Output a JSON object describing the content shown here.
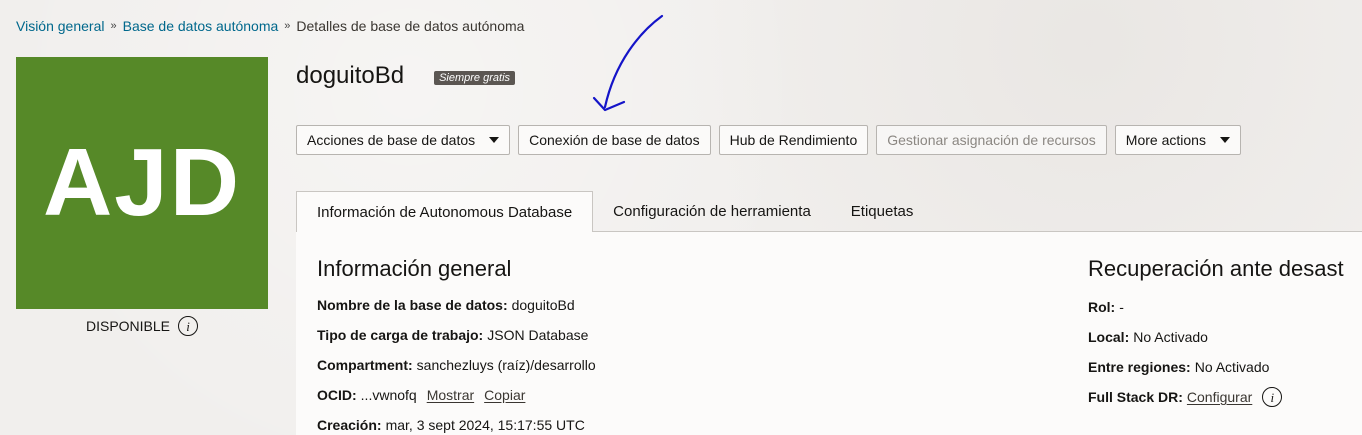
{
  "breadcrumb": {
    "items": [
      "Visión general",
      "Base de datos autónoma"
    ],
    "current": "Detalles de base de datos autónoma",
    "separator": "»"
  },
  "logo": {
    "text": "AJD",
    "color": "#568928"
  },
  "status": {
    "label": "DISPONIBLE",
    "icon": "info-icon"
  },
  "header": {
    "title": "doguitoBd",
    "badge": "Siempre gratis"
  },
  "toolbar": {
    "db_actions": "Acciones de base de datos",
    "db_connection": "Conexión de base de datos",
    "perf_hub": "Hub de Rendimiento",
    "manage_resources": "Gestionar asignación de recursos",
    "more_actions": "More actions"
  },
  "tabs": [
    {
      "label": "Información de Autonomous Database"
    },
    {
      "label": "Configuración de herramienta"
    },
    {
      "label": "Etiquetas"
    }
  ],
  "general_info": {
    "title": "Información general",
    "db_name_label": "Nombre de la base de datos:",
    "db_name_value": "doguitoBd",
    "workload_label": "Tipo de carga de trabajo:",
    "workload_value": "JSON Database",
    "compartment_label": "Compartment:",
    "compartment_value": "sanchezluys (raíz)/desarrollo",
    "ocid_label": "OCID:",
    "ocid_value": "...vwnofq",
    "ocid_show": "Mostrar",
    "ocid_copy": "Copiar",
    "created_label": "Creación:",
    "created_value": "mar, 3 sept 2024, 15:17:55 UTC"
  },
  "disaster_recovery": {
    "title": "Recuperación ante desast",
    "role_label": "Rol:",
    "role_value": "-",
    "local_label": "Local:",
    "local_value": "No Activado",
    "cross_region_label": "Entre regiones:",
    "cross_region_value": "No Activado",
    "full_stack_label": "Full Stack DR:",
    "full_stack_link": "Configurar"
  }
}
